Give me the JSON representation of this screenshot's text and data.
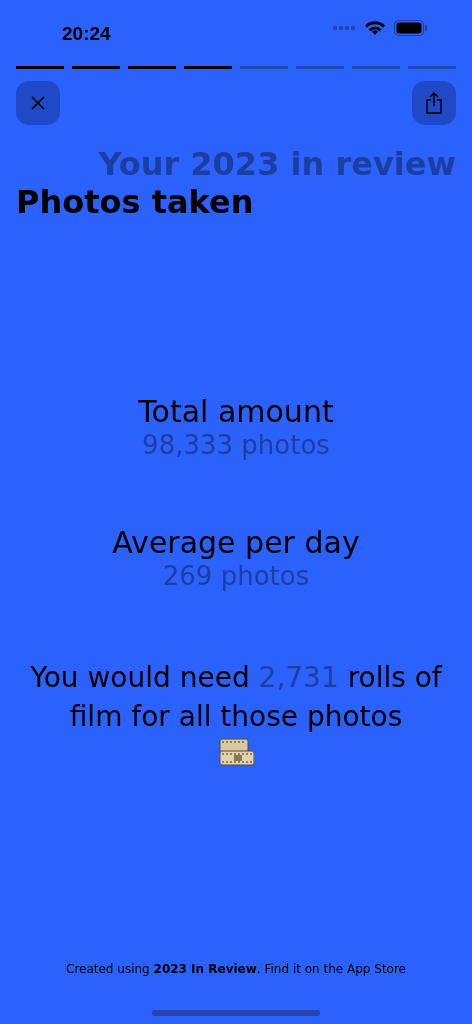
{
  "status_bar": {
    "time": "20:24"
  },
  "progress": [
    {
      "done": true
    },
    {
      "done": true
    },
    {
      "done": true
    },
    {
      "done": true
    },
    {
      "done": false
    },
    {
      "done": false
    },
    {
      "done": false
    },
    {
      "done": false
    }
  ],
  "header": {
    "kicker": "Your 2023 in review",
    "title": "Photos taken"
  },
  "stats": [
    {
      "label": "Total amount",
      "value": "98,333 photos"
    },
    {
      "label": "Average per day",
      "value": "269 photos"
    }
  ],
  "fact": {
    "parts": [
      {
        "text": "You would need ",
        "highlight": false
      },
      {
        "text": "2,731",
        "highlight": true
      },
      {
        "text": " rolls of film for all those photos",
        "highlight": false
      }
    ]
  },
  "footer": "Created using **2023 In Review**. Find it on the App Store"
}
